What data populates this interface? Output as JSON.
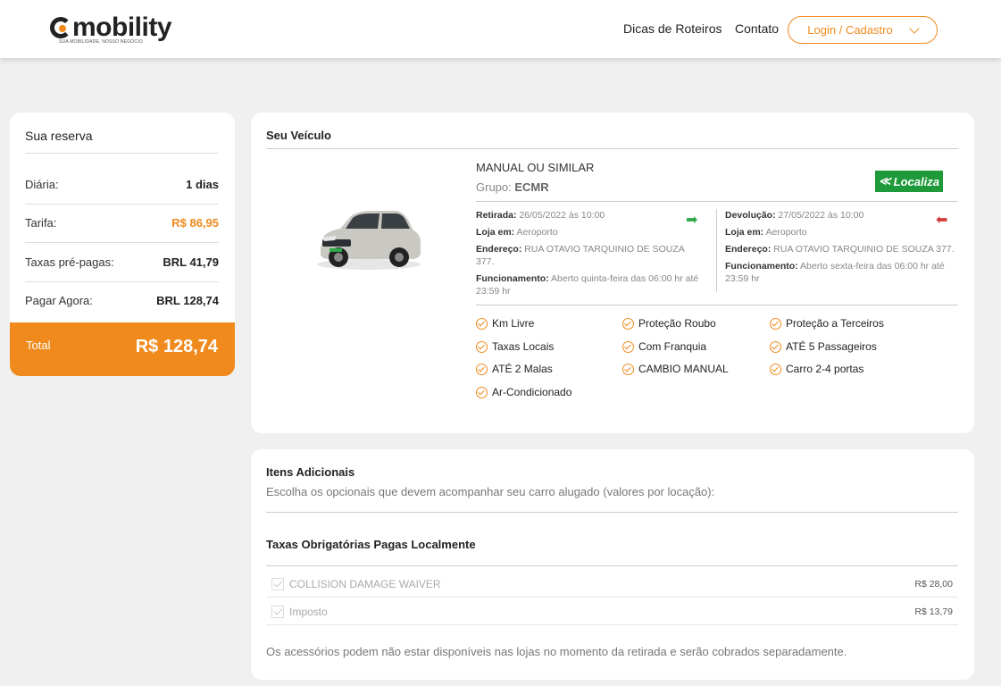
{
  "header": {
    "logo_text": "mobility",
    "logo_tagline": "SUA MOBILIDADE, NOSSO NEGÓCIO",
    "nav": {
      "roteiros": "Dicas de Roteiros",
      "contato": "Contato",
      "login": "Login / Cadastro"
    }
  },
  "reserva": {
    "title": "Sua reserva",
    "rows": [
      {
        "label": "Diária:",
        "value": "1 dias"
      },
      {
        "label": "Tarifa:",
        "value": "R$ 86,95"
      },
      {
        "label": "Taxas pré-pagas:",
        "value": "BRL 41,79"
      },
      {
        "label": "Pagar Agora:",
        "value": "BRL 128,74"
      }
    ],
    "total_label": "Total",
    "total_value": "R$ 128,74"
  },
  "veiculo": {
    "title": "Seu Veículo",
    "model": "MANUAL OU SIMILAR",
    "grupo_label": "Grupo:",
    "grupo_value": "ECMR",
    "rental_company": "Localiza",
    "retirada": {
      "label": "Retirada:",
      "date": "26/05/2022 às 10:00",
      "loja_label": "Loja em:",
      "loja": "Aeroporto",
      "endereco_label": "Endereço:",
      "endereco": "RUA OTAVIO TARQUINIO DE SOUZA 377.",
      "funcionamento_label": "Funcionamento:",
      "funcionamento": "Aberto quinta-feira das 06:00 hr até 23:59 hr"
    },
    "devolucao": {
      "label": "Devolução:",
      "date": "27/05/2022 às 10:00",
      "loja_label": "Loja em:",
      "loja": "Aeroporto",
      "endereco_label": "Endereço:",
      "endereco": "RUA OTAVIO TARQUINIO DE SOUZA 377.",
      "funcionamento_label": "Funcionamento:",
      "funcionamento": "Aberto sexta-feira das 06:00 hr até 23:59 hr"
    },
    "features": [
      "Km Livre",
      "Proteção Roubo",
      "Proteção a Terceiros",
      "Taxas Locais",
      "Com Franquia",
      "ATÉ 5 Passageiros",
      "ATÉ 2 Malas",
      "CAMBIO MANUAL",
      "Carro 2-4 portas",
      "Ar-Condicionado"
    ],
    "colors": {
      "accent": "#f08a1d",
      "pickup_arrow": "#2ea84a",
      "return_arrow": "#d33a3a",
      "brand_green": "#1f9a3b"
    }
  },
  "itens": {
    "title": "Itens Adicionais",
    "subtitle": "Escolha os opcionais que devem acompanhar seu carro alugado (valores por locação):",
    "taxas_title": "Taxas Obrigatórias Pagas Localmente",
    "fees": [
      {
        "name": "COLLISION DAMAGE WAIVER",
        "price": "R$ 28,00",
        "checked": true
      },
      {
        "name": "Imposto",
        "price": "R$ 13,79",
        "checked": true
      }
    ],
    "note": "Os acessórios podem não estar disponíveis nas lojas no momento da retirada e serão cobrados separadamente."
  }
}
